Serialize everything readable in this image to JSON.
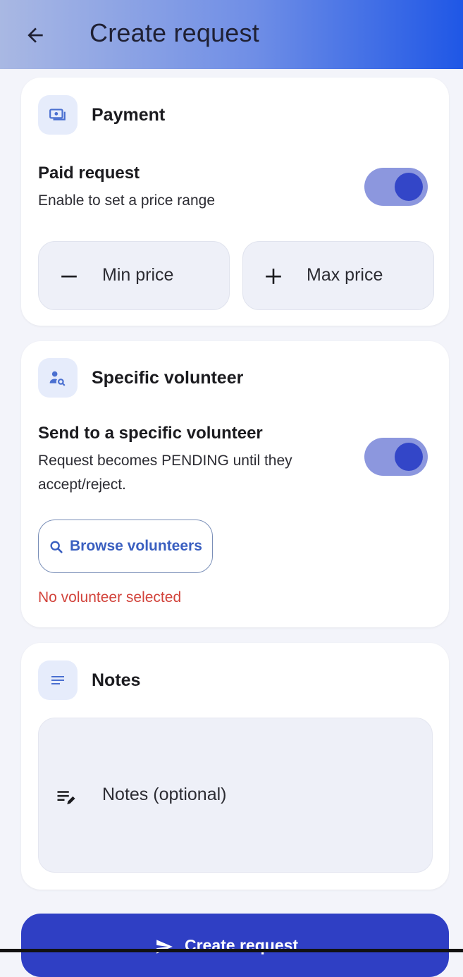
{
  "appbar": {
    "title": "Create request",
    "back_icon": "arrow-left-icon"
  },
  "payment": {
    "title": "Payment",
    "icon": "money-icon",
    "switch_title": "Paid request",
    "switch_subtitle": "Enable to set a price range",
    "enabled": true,
    "min_label": "Min price",
    "max_label": "Max price"
  },
  "volunteer": {
    "title": "Specific volunteer",
    "icon": "person-search-icon",
    "switch_title": "Send to a specific volunteer",
    "switch_subtitle_1": "Request becomes PENDING until they",
    "switch_subtitle_2": "accept/reject.",
    "enabled": true,
    "browse_label": "Browse volunteers",
    "status": "No volunteer selected"
  },
  "notes": {
    "title": "Notes",
    "icon": "notes-icon",
    "placeholder": "Notes (optional)"
  },
  "submit": {
    "label": "Create request",
    "icon": "send-icon"
  },
  "colors": {
    "accent": "#2f3fc4",
    "toggle_track": "#8c97de",
    "error": "#d2433b"
  }
}
